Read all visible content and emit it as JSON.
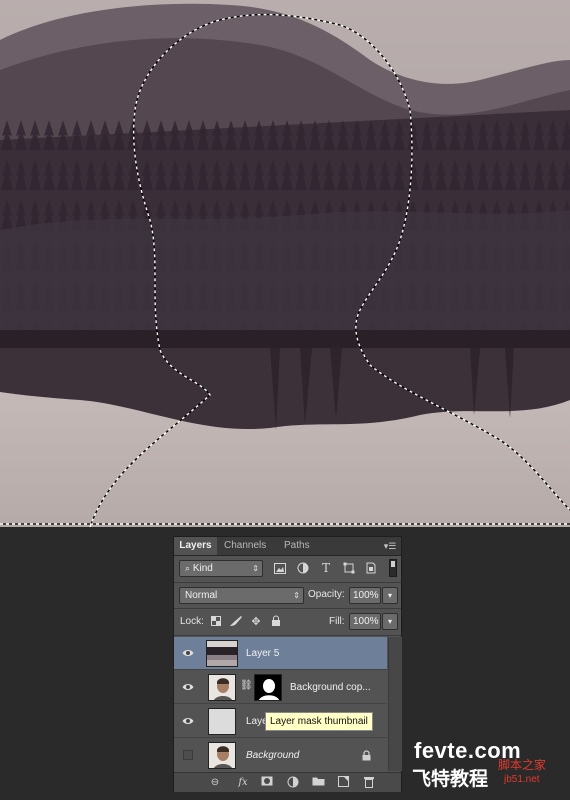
{
  "panel": {
    "tabs": [
      {
        "label": "Layers",
        "active": true
      },
      {
        "label": "Channels",
        "active": false
      },
      {
        "label": "Paths",
        "active": false
      }
    ],
    "menu_icon": "panel-menu-icon",
    "filter": {
      "kind_label": "Kind",
      "kind_icon": "search-icon",
      "filter_icons": [
        "image-filter-icon",
        "adjustment-filter-icon",
        "type-filter-icon",
        "shape-filter-icon",
        "smart-object-filter-icon"
      ]
    },
    "blend_mode": "Normal",
    "opacity_label": "Opacity:",
    "opacity_value": "100%",
    "lock_label": "Lock:",
    "fill_label": "Fill:",
    "fill_value": "100%",
    "lock_icons": [
      "lock-transparent-icon",
      "lock-paint-icon",
      "lock-move-icon",
      "lock-all-icon"
    ],
    "layers": [
      {
        "name": "Layer 5",
        "visible": true,
        "selected": true,
        "italic": false
      },
      {
        "name": "Background cop...",
        "visible": true,
        "selected": false,
        "italic": false,
        "has_mask": true
      },
      {
        "name": "Laye",
        "visible": true,
        "selected": false,
        "italic": false
      },
      {
        "name": "Background",
        "visible": false,
        "selected": false,
        "italic": true,
        "locked": true
      }
    ],
    "bottom_icons": [
      "link-icon",
      "fx-icon",
      "add-mask-icon",
      "adjustment-layer-icon",
      "group-folder-icon",
      "new-layer-icon",
      "trash-icon"
    ],
    "fx_label": "fx"
  },
  "tooltip": "Layer mask thumbnail",
  "watermark": {
    "main": "fevte.com",
    "sub": "飞特教程",
    "red": "脚本之家",
    "red2": "jb51.net"
  },
  "colors": {
    "panel_bg": "#535353",
    "selected_row": "#6e7f99",
    "tooltip_bg": "#ffffc6",
    "background": "#2a2a2a"
  }
}
